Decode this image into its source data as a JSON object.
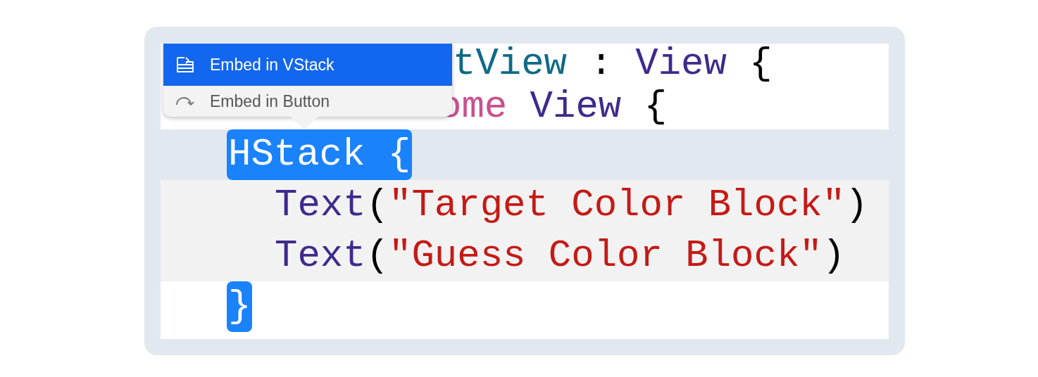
{
  "editor": {
    "lines": [
      {
        "highlighted": false,
        "tokens": [
          {
            "text": "tView",
            "color": "#0f6a87",
            "selected": false
          },
          {
            "text": " : ",
            "color": "#000000",
            "selected": false
          },
          {
            "text": "View",
            "color": "#3f2a8c",
            "selected": false
          },
          {
            "text": " {",
            "color": "#000000",
            "selected": false
          }
        ]
      },
      {
        "highlighted": false,
        "tokens": [
          {
            "text": "ome",
            "color": "#c9508f",
            "selected": false
          },
          {
            "text": " View",
            "color": "#3f2a8c",
            "selected": false
          },
          {
            "text": " {",
            "color": "#000000",
            "selected": false
          }
        ]
      },
      {
        "highlighted": true,
        "tokens": [
          {
            "text": "HStack {",
            "selected": true
          }
        ]
      },
      {
        "highlighted": false,
        "tokens": [
          {
            "text": "Text",
            "color": "#3f2a8c",
            "selected": false
          },
          {
            "text": "(",
            "color": "#000000",
            "selected": false
          },
          {
            "text": "\"Target Color Block\"",
            "color": "#c41a16",
            "selected": false
          },
          {
            "text": ")",
            "color": "#000000",
            "selected": false
          }
        ]
      },
      {
        "highlighted": false,
        "tokens": [
          {
            "text": "Text",
            "color": "#3f2a8c",
            "selected": false
          },
          {
            "text": "(",
            "color": "#000000",
            "selected": false
          },
          {
            "text": "\"Guess Color Block\"",
            "color": "#c41a16",
            "selected": false
          },
          {
            "text": ")",
            "color": "#000000",
            "selected": false
          }
        ]
      },
      {
        "highlighted": false,
        "tokens": [
          {
            "text": "}",
            "selected": true
          }
        ]
      }
    ]
  },
  "menu": {
    "items": [
      {
        "label": "Embed in VStack",
        "selected": true
      },
      {
        "label": "Embed in Button",
        "selected": false
      }
    ]
  }
}
